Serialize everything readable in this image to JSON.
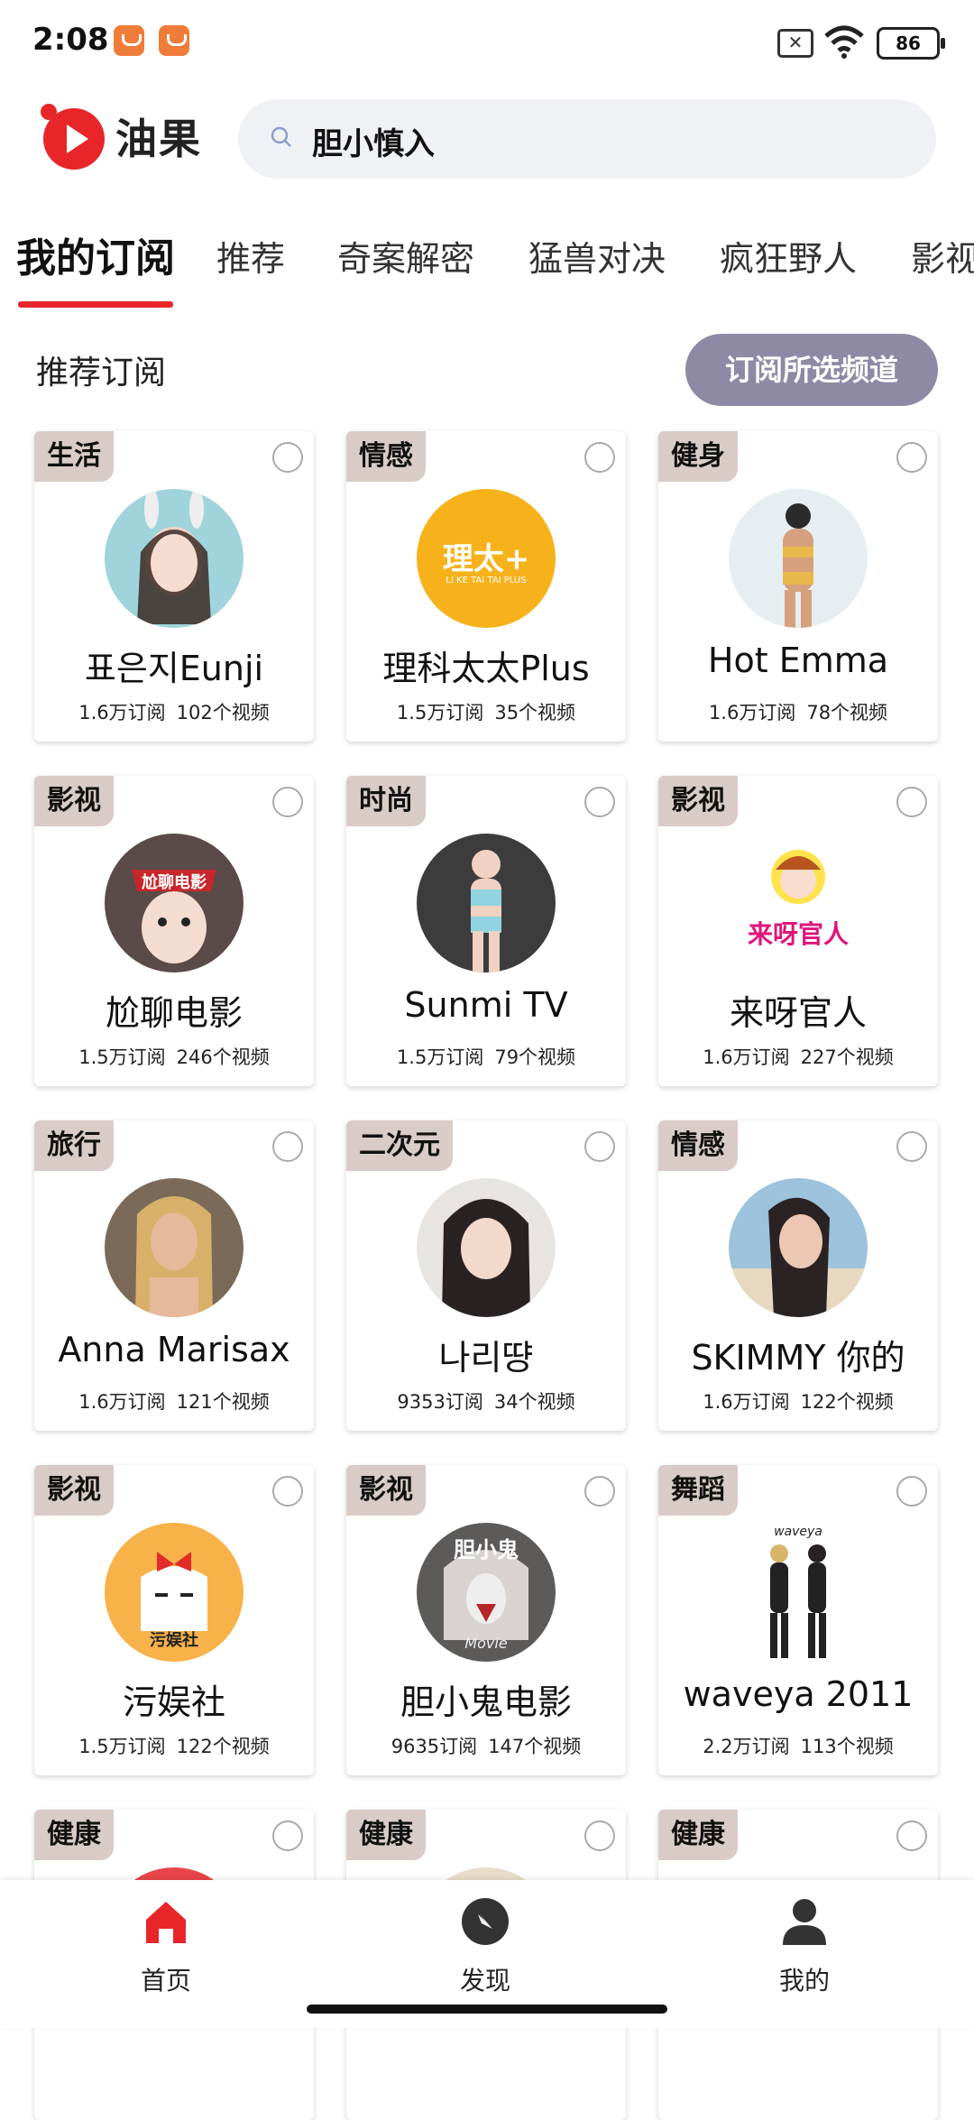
{
  "status_bar": {
    "time": "2:08",
    "battery": "86"
  },
  "header": {
    "brand": "油果",
    "search_value": "胆小慎入"
  },
  "tabs": [
    "我的订阅",
    "推荐",
    "奇案解密",
    "猛兽对决",
    "疯狂野人",
    "影视"
  ],
  "section": {
    "title": "推荐订阅",
    "subscribe_button": "订阅所选频道"
  },
  "cards": [
    {
      "category": "生活",
      "name": "표은지Eunji",
      "subs": "1.6万订阅",
      "videos": "102个视频"
    },
    {
      "category": "情感",
      "name": "理科太太Plus",
      "subs": "1.5万订阅",
      "videos": "35个视频",
      "avatar_text": "理太+",
      "avatar_sub": "LI KE TAI TAI PLUS"
    },
    {
      "category": "健身",
      "name": "Hot Emma",
      "subs": "1.6万订阅",
      "videos": "78个视频"
    },
    {
      "category": "影视",
      "name": "尬聊电影",
      "subs": "1.5万订阅",
      "videos": "246个视频",
      "avatar_text": "尬聊电影"
    },
    {
      "category": "时尚",
      "name": "Sunmi TV",
      "subs": "1.5万订阅",
      "videos": "79个视频"
    },
    {
      "category": "影视",
      "name": "来呀官人",
      "subs": "1.6万订阅",
      "videos": "227个视频",
      "avatar_text": "来呀官人"
    },
    {
      "category": "旅行",
      "name": "Anna Marisax",
      "subs": "1.6万订阅",
      "videos": "121个视频"
    },
    {
      "category": "二次元",
      "name": "나리땽",
      "subs": "9353订阅",
      "videos": "34个视频"
    },
    {
      "category": "情感",
      "name": "SKIMMY 你的",
      "subs": "1.6万订阅",
      "videos": "122个视频"
    },
    {
      "category": "影视",
      "name": "污娱社",
      "subs": "1.5万订阅",
      "videos": "122个视频",
      "avatar_text": "污娱社"
    },
    {
      "category": "影视",
      "name": "胆小鬼电影",
      "subs": "9635订阅",
      "videos": "147个视频",
      "avatar_text": "胆小鬼",
      "avatar_sub": "Movie"
    },
    {
      "category": "舞蹈",
      "name": "waveya 2011",
      "subs": "2.2万订阅",
      "videos": "113个视频",
      "avatar_text": "waveya"
    },
    {
      "category": "健康",
      "name": "",
      "subs": "",
      "videos": ""
    },
    {
      "category": "健康",
      "name": "",
      "subs": "",
      "videos": ""
    },
    {
      "category": "健康",
      "name": "",
      "subs": "",
      "videos": ""
    }
  ],
  "bottom_nav": [
    {
      "label": "首页",
      "icon": "home-icon",
      "active": true
    },
    {
      "label": "发现",
      "icon": "compass-icon",
      "active": false
    },
    {
      "label": "我的",
      "icon": "user-icon",
      "active": false
    }
  ],
  "colors": {
    "accent": "#e8262a",
    "subscribe_button": "#8e8aa5",
    "category_tag": "#d9ccc7"
  }
}
